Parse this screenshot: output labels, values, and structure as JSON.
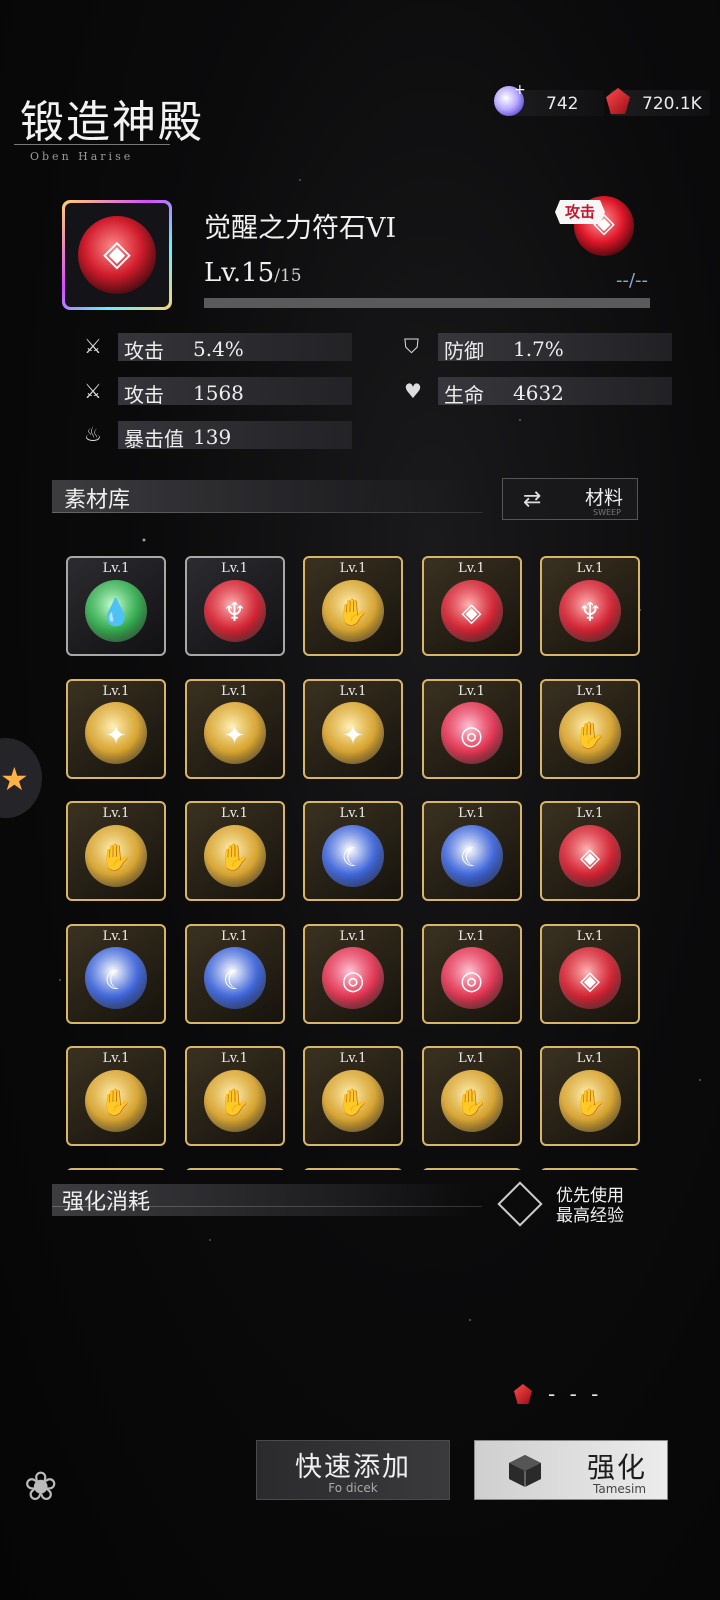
{
  "header": {
    "title": "锻造神殿",
    "subtitle": "Oben Harise"
  },
  "currency": [
    {
      "icon": "crystal-icon",
      "value": "742"
    },
    {
      "icon": "ruby-icon",
      "value": "720.1K"
    }
  ],
  "item": {
    "name": "觉醒之力符石VI",
    "level": "Lv.15",
    "level_max": "/15",
    "exp_text": "--/--",
    "badge": "攻击",
    "exp_fraction": 1.0
  },
  "stats": [
    {
      "icon": "sword-icon",
      "label": "攻击",
      "value": "5.4%"
    },
    {
      "icon": "shield-icon",
      "label": "防御",
      "value": "1.7%"
    },
    {
      "icon": "sword-icon",
      "label": "攻击",
      "value": "1568"
    },
    {
      "icon": "heart-icon",
      "label": "生命",
      "value": "4632"
    },
    {
      "icon": "flame-icon",
      "label": "暴击值",
      "value": "139"
    }
  ],
  "materials": {
    "title": "素材库",
    "button_label": "材料",
    "button_sub": "SWEEP",
    "tiles": [
      {
        "level": "Lv.1",
        "kind": "green-drop",
        "frame": "silver"
      },
      {
        "level": "Lv.1",
        "kind": "red-tree",
        "frame": "silver"
      },
      {
        "level": "Lv.1",
        "kind": "gold-claw",
        "frame": "gold"
      },
      {
        "level": "Lv.1",
        "kind": "red-diamond",
        "frame": "gold"
      },
      {
        "level": "Lv.1",
        "kind": "red-tree",
        "frame": "gold"
      },
      {
        "level": "Lv.1",
        "kind": "gold-star",
        "frame": "gold"
      },
      {
        "level": "Lv.1",
        "kind": "gold-star",
        "frame": "gold"
      },
      {
        "level": "Lv.1",
        "kind": "gold-star",
        "frame": "gold"
      },
      {
        "level": "Lv.1",
        "kind": "red-swirl",
        "frame": "gold"
      },
      {
        "level": "Lv.1",
        "kind": "gold-claw",
        "frame": "gold"
      },
      {
        "level": "Lv.1",
        "kind": "gold-claw",
        "frame": "gold"
      },
      {
        "level": "Lv.1",
        "kind": "gold-claw",
        "frame": "gold"
      },
      {
        "level": "Lv.1",
        "kind": "blue-moon",
        "frame": "gold"
      },
      {
        "level": "Lv.1",
        "kind": "blue-moon",
        "frame": "gold"
      },
      {
        "level": "Lv.1",
        "kind": "red-diamond",
        "frame": "gold"
      },
      {
        "level": "Lv.1",
        "kind": "blue-moon",
        "frame": "gold"
      },
      {
        "level": "Lv.1",
        "kind": "blue-moon",
        "frame": "gold"
      },
      {
        "level": "Lv.1",
        "kind": "red-swirl",
        "frame": "gold"
      },
      {
        "level": "Lv.1",
        "kind": "red-swirl",
        "frame": "gold"
      },
      {
        "level": "Lv.1",
        "kind": "red-diamond",
        "frame": "gold"
      },
      {
        "level": "Lv.1",
        "kind": "gold-claw",
        "frame": "gold"
      },
      {
        "level": "Lv.1",
        "kind": "gold-claw",
        "frame": "gold"
      },
      {
        "level": "Lv.1",
        "kind": "gold-claw",
        "frame": "gold"
      },
      {
        "level": "Lv.1",
        "kind": "gold-claw",
        "frame": "gold"
      },
      {
        "level": "Lv.1",
        "kind": "gold-claw",
        "frame": "gold"
      }
    ]
  },
  "consume": {
    "title": "强化消耗",
    "priority_line1": "优先使用",
    "priority_line2": "最高经验",
    "cost": "- - -"
  },
  "buttons": {
    "quick_add": "快速添加",
    "quick_add_sub": "Fo dicek",
    "enhance": "强化",
    "enhance_sub": "Tamesim"
  },
  "colors": {
    "gold_frame": "#d9b56a",
    "silver_frame": "#a8a8a8",
    "accent_red": "#c3162a"
  }
}
